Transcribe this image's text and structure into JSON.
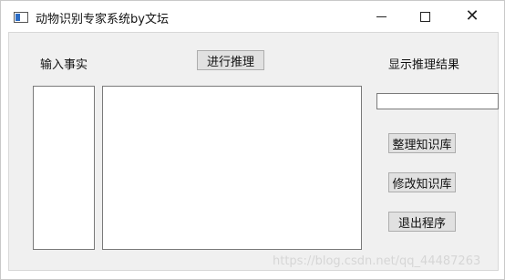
{
  "window": {
    "title": "动物识别专家系统by文坛",
    "controls": {
      "minimize": "—",
      "maximize": "☐",
      "close": "✕"
    }
  },
  "labels": {
    "input_facts": "输入事实",
    "show_result": "显示推理结果"
  },
  "buttons": {
    "infer": "进行推理",
    "organize_kb": "整理知识库",
    "modify_kb": "修改知识库",
    "exit": "退出程序"
  },
  "fields": {
    "result_value": ""
  },
  "watermark": "https://blog.csdn.net/qq_44487263"
}
